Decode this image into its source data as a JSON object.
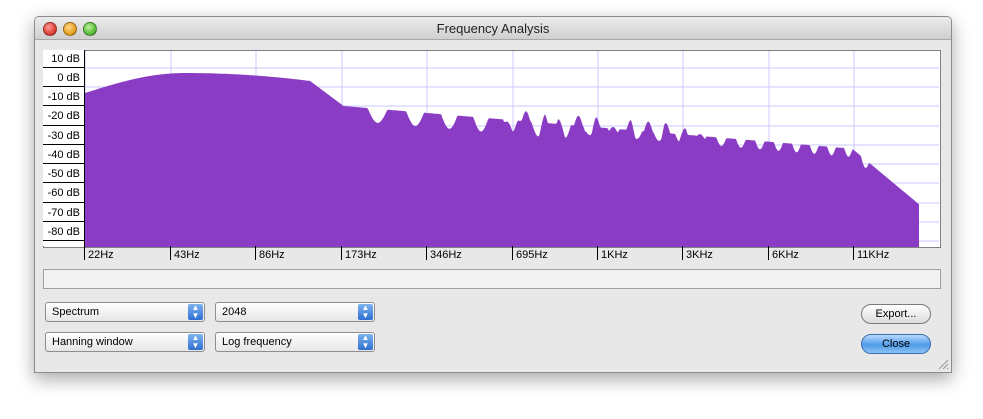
{
  "window": {
    "title": "Frequency Analysis"
  },
  "plot": {
    "y_labels": [
      "10 dB",
      "0 dB",
      "-10 dB",
      "-20 dB",
      "-30 dB",
      "-40 dB",
      "-50 dB",
      "-60 dB",
      "-70 dB",
      "-80 dB"
    ],
    "x_labels": [
      "22Hz",
      "43Hz",
      "86Hz",
      "173Hz",
      "346Hz",
      "695Hz",
      "1KHz",
      "3KHz",
      "6KHz",
      "11KHz"
    ],
    "fill_color": "#8a3cc4",
    "grid_color": "#c8c8ff"
  },
  "controls": {
    "algorithm": "Spectrum",
    "size": "2048",
    "window_function": "Hanning window",
    "axis": "Log frequency",
    "export_label": "Export...",
    "close_label": "Close"
  }
}
